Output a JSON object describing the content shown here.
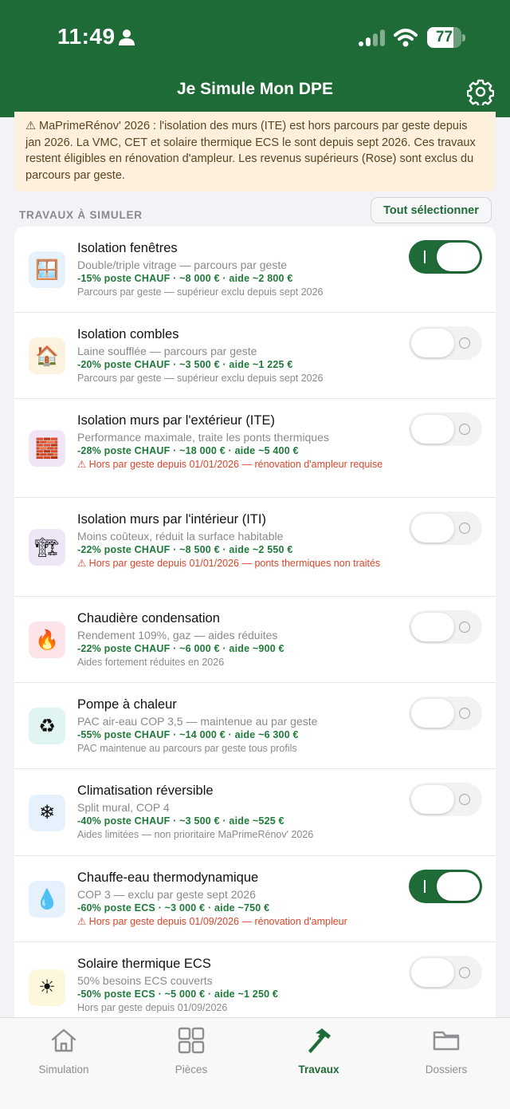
{
  "status_bar": {
    "time": "11:49",
    "battery_percent": "77",
    "battery_level": 0.77,
    "person_icon": "person-icon",
    "signal_icon": "signal-icon",
    "wifi_icon": "wifi-icon"
  },
  "header": {
    "title": "Je Simule Mon DPE",
    "settings_icon": "gear-icon"
  },
  "warning": {
    "text": "⚠ MaPrimeRénov' 2026 : l'isolation des murs (ITE) est hors parcours par geste depuis jan 2026. La VMC, CET et solaire thermique ECS le sont depuis sept 2026. Ces travaux restent éligibles en rénovation d'ampleur. Les revenus supérieurs (Rose) sont exclus du parcours par geste."
  },
  "section": {
    "title": "TRAVAUX À SIMULER",
    "select_all_label": "Tout sélectionner"
  },
  "colors": {
    "brand": "#1f6b37",
    "metrics": "#1f7a3a",
    "alert": "#d9462b",
    "warning_bg": "#fdf0dc"
  },
  "works": [
    {
      "title": "Isolation fenêtres",
      "description": "Double/triple vitrage — parcours par geste",
      "metrics": "-15% poste CHAUF · ~8 000 € · aide ~2 800 €",
      "note": "Parcours par geste — supérieur exclu depuis sept 2026",
      "note_is_alert": false,
      "enabled": true,
      "icon": "window-icon",
      "glyph": "🪟",
      "icon_bg": "#e5f1fc"
    },
    {
      "title": "Isolation combles",
      "description": "Laine soufflée — parcours par geste",
      "metrics": "-20% poste CHAUF · ~3 500 € · aide ~1 225 €",
      "note": "Parcours par geste — supérieur exclu depuis sept 2026",
      "note_is_alert": false,
      "enabled": false,
      "icon": "house-icon",
      "glyph": "🏠",
      "icon_bg": "#fdf1e0"
    },
    {
      "title": "Isolation murs par l'extérieur (ITE)",
      "description": "Performance maximale, traite les ponts thermiques",
      "metrics": "-28% poste CHAUF · ~18 000 € · aide ~5 400 €",
      "note": "⚠ Hors par geste depuis 01/01/2026 — rénovation d'ampleur requise",
      "note_is_alert": true,
      "enabled": false,
      "icon": "bricks-icon",
      "glyph": "🧱",
      "icon_bg": "#f1e4f6"
    },
    {
      "title": "Isolation murs par l'intérieur (ITI)",
      "description": "Moins coûteux, réduit la surface habitable",
      "metrics": "-22% poste CHAUF · ~8 500 € · aide ~2 550 €",
      "note": "⚠ Hors par geste depuis 01/01/2026 — ponts thermiques non traités",
      "note_is_alert": true,
      "enabled": false,
      "icon": "construction-crane-icon",
      "glyph": "🏗",
      "icon_bg": "#ece6f6"
    },
    {
      "title": "Chaudière condensation",
      "description": "Rendement 109%, gaz — aides réduites",
      "metrics": "-22% poste CHAUF · ~6 000 € · aide ~900 €",
      "note": "Aides fortement réduites en 2026",
      "note_is_alert": false,
      "enabled": false,
      "icon": "flame-icon",
      "glyph": "🔥",
      "icon_bg": "#fde4e8"
    },
    {
      "title": "Pompe à chaleur",
      "description": "PAC air-eau COP 3,5 — maintenue au par geste",
      "metrics": "-55% poste CHAUF · ~14 000 € · aide ~6 300 €",
      "note": "PAC maintenue au parcours par geste tous profils",
      "note_is_alert": false,
      "enabled": false,
      "icon": "recycle-icon",
      "glyph": "♻",
      "icon_bg": "#e0f4f2"
    },
    {
      "title": "Climatisation réversible",
      "description": "Split mural, COP 4",
      "metrics": "-40% poste CHAUF · ~3 500 € · aide ~525 €",
      "note": "Aides limitées — non prioritaire MaPrimeRénov' 2026",
      "note_is_alert": false,
      "enabled": false,
      "icon": "snowflake-icon",
      "glyph": "❄",
      "icon_bg": "#e5f1fc"
    },
    {
      "title": "Chauffe-eau thermodynamique",
      "description": "COP 3 — exclu par geste sept 2026",
      "metrics": "-60% poste ECS · ~3 000 € · aide ~750 €",
      "note": "⚠ Hors par geste depuis 01/09/2026 — rénovation d'ampleur",
      "note_is_alert": true,
      "enabled": true,
      "icon": "water-drop-icon",
      "glyph": "💧",
      "icon_bg": "#e5f1fc"
    },
    {
      "title": "Solaire thermique ECS",
      "description": "50% besoins ECS couverts",
      "metrics": "-50% poste ECS · ~5 000 € · aide ~1 250 €",
      "note": "Hors par geste depuis 01/09/2026",
      "note_is_alert": false,
      "enabled": false,
      "icon": "sun-icon",
      "glyph": "☀",
      "icon_bg": "#fdf7dc"
    }
  ],
  "tabs": [
    {
      "label": "Simulation",
      "icon": "house-icon",
      "active": false
    },
    {
      "label": "Pièces",
      "icon": "grid-icon",
      "active": false
    },
    {
      "label": "Travaux",
      "icon": "hammer-icon",
      "active": true
    },
    {
      "label": "Dossiers",
      "icon": "folder-icon",
      "active": false
    }
  ]
}
